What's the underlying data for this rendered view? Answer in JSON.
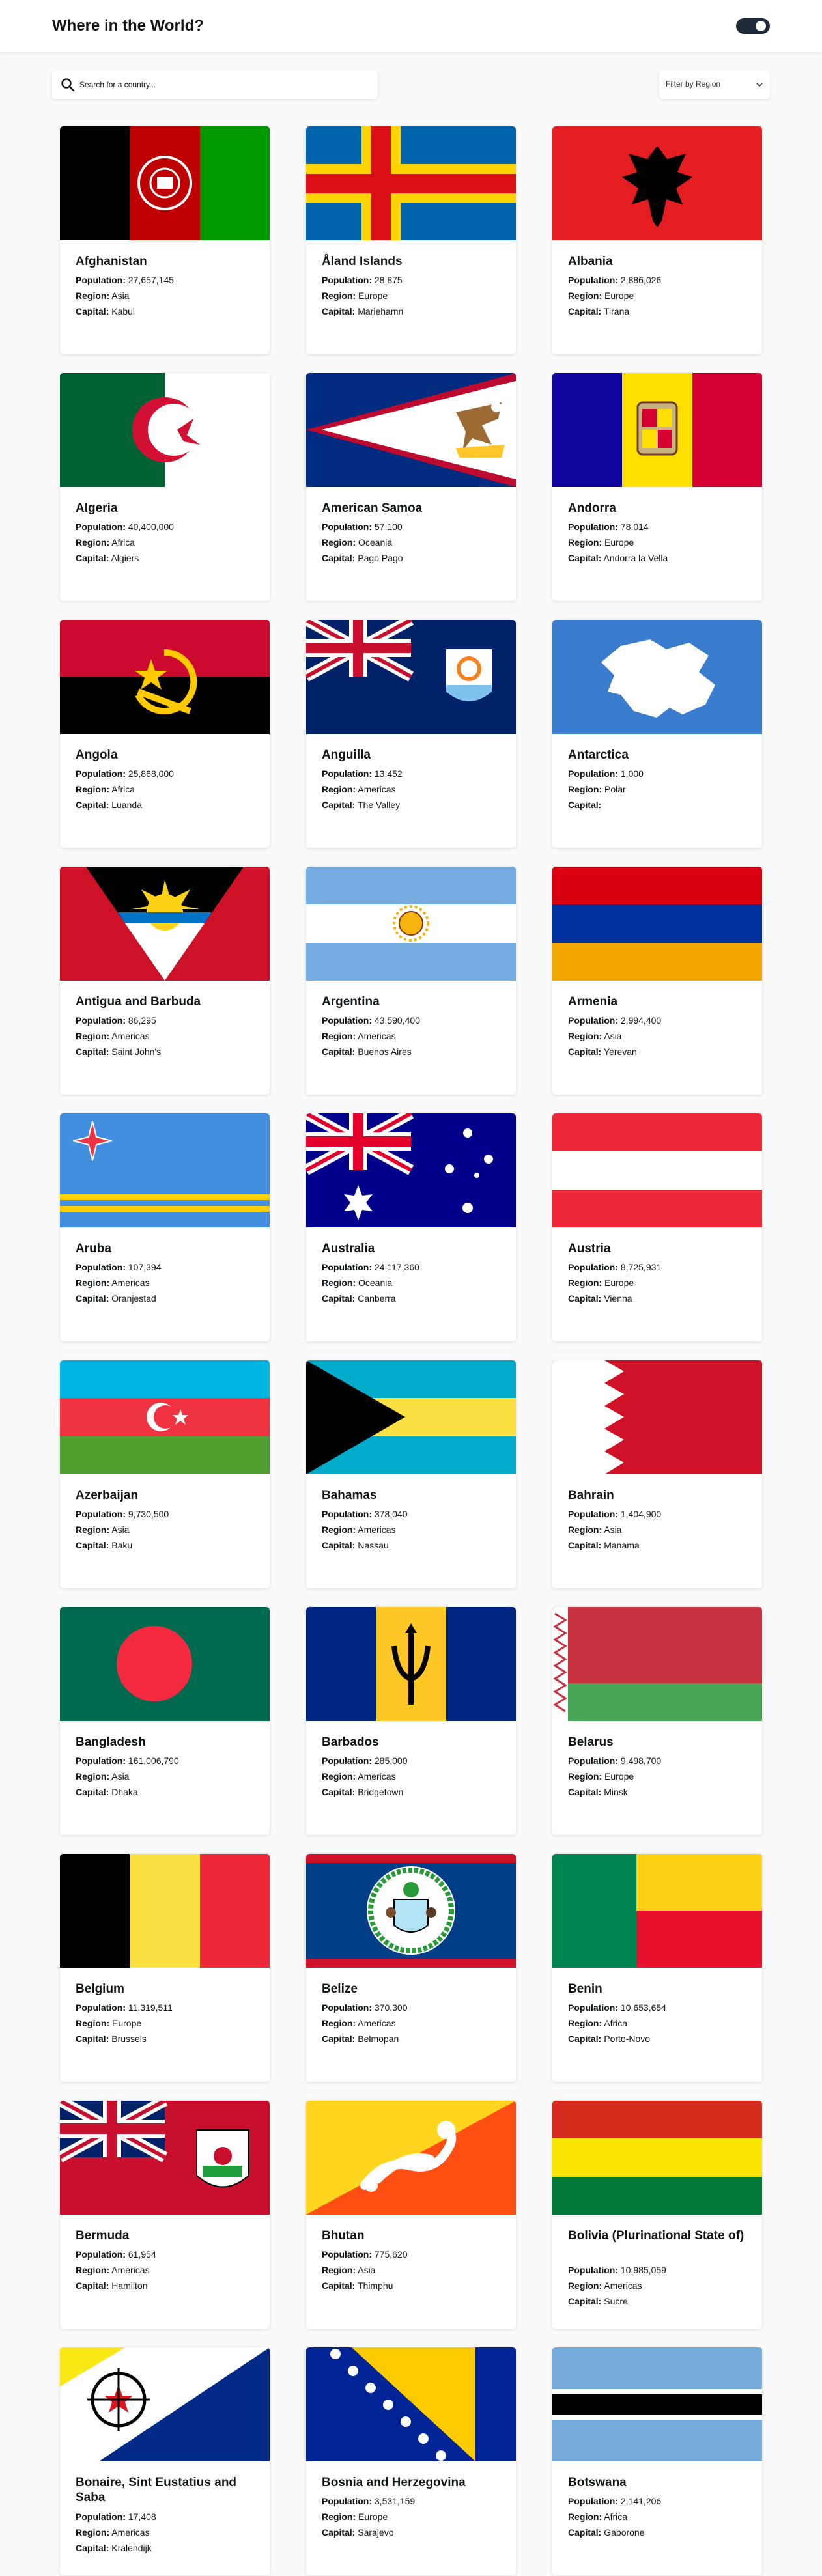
{
  "header": {
    "title": "Where in the World?",
    "theme_toggle": "dark-mode-toggle"
  },
  "search": {
    "placeholder": "Search for a country..."
  },
  "filter": {
    "label": "Filter by Region"
  },
  "labels": {
    "population": "Population:",
    "region": "Region:",
    "capital": "Capital:"
  },
  "countries": [
    {
      "name": "Afghanistan",
      "population": "27,657,145",
      "region": "Asia",
      "capital": "Kabul",
      "flag": "afghanistan"
    },
    {
      "name": "Åland Islands",
      "population": "28,875",
      "region": "Europe",
      "capital": "Mariehamn",
      "flag": "aland"
    },
    {
      "name": "Albania",
      "population": "2,886,026",
      "region": "Europe",
      "capital": "Tirana",
      "flag": "albania"
    },
    {
      "name": "Algeria",
      "population": "40,400,000",
      "region": "Africa",
      "capital": "Algiers",
      "flag": "algeria"
    },
    {
      "name": "American Samoa",
      "population": "57,100",
      "region": "Oceania",
      "capital": "Pago Pago",
      "flag": "american-samoa"
    },
    {
      "name": "Andorra",
      "population": "78,014",
      "region": "Europe",
      "capital": "Andorra la Vella",
      "flag": "andorra"
    },
    {
      "name": "Angola",
      "population": "25,868,000",
      "region": "Africa",
      "capital": "Luanda",
      "flag": "angola"
    },
    {
      "name": "Anguilla",
      "population": "13,452",
      "region": "Americas",
      "capital": "The Valley",
      "flag": "anguilla"
    },
    {
      "name": "Antarctica",
      "population": "1,000",
      "region": "Polar",
      "capital": "",
      "flag": "antarctica"
    },
    {
      "name": "Antigua and Barbuda",
      "population": "86,295",
      "region": "Americas",
      "capital": "Saint John's",
      "flag": "antigua"
    },
    {
      "name": "Argentina",
      "population": "43,590,400",
      "region": "Americas",
      "capital": "Buenos Aires",
      "flag": "argentina"
    },
    {
      "name": "Armenia",
      "population": "2,994,400",
      "region": "Asia",
      "capital": "Yerevan",
      "flag": "armenia"
    },
    {
      "name": "Aruba",
      "population": "107,394",
      "region": "Americas",
      "capital": "Oranjestad",
      "flag": "aruba"
    },
    {
      "name": "Australia",
      "population": "24,117,360",
      "region": "Oceania",
      "capital": "Canberra",
      "flag": "australia"
    },
    {
      "name": "Austria",
      "population": "8,725,931",
      "region": "Europe",
      "capital": "Vienna",
      "flag": "austria"
    },
    {
      "name": "Azerbaijan",
      "population": "9,730,500",
      "region": "Asia",
      "capital": "Baku",
      "flag": "azerbaijan"
    },
    {
      "name": "Bahamas",
      "population": "378,040",
      "region": "Americas",
      "capital": "Nassau",
      "flag": "bahamas"
    },
    {
      "name": "Bahrain",
      "population": "1,404,900",
      "region": "Asia",
      "capital": "Manama",
      "flag": "bahrain"
    },
    {
      "name": "Bangladesh",
      "population": "161,006,790",
      "region": "Asia",
      "capital": "Dhaka",
      "flag": "bangladesh"
    },
    {
      "name": "Barbados",
      "population": "285,000",
      "region": "Americas",
      "capital": "Bridgetown",
      "flag": "barbados"
    },
    {
      "name": "Belarus",
      "population": "9,498,700",
      "region": "Europe",
      "capital": "Minsk",
      "flag": "belarus"
    },
    {
      "name": "Belgium",
      "population": "11,319,511",
      "region": "Europe",
      "capital": "Brussels",
      "flag": "belgium"
    },
    {
      "name": "Belize",
      "population": "370,300",
      "region": "Americas",
      "capital": "Belmopan",
      "flag": "belize"
    },
    {
      "name": "Benin",
      "population": "10,653,654",
      "region": "Africa",
      "capital": "Porto-Novo",
      "flag": "benin"
    },
    {
      "name": "Bermuda",
      "population": "61,954",
      "region": "Americas",
      "capital": "Hamilton",
      "flag": "bermuda"
    },
    {
      "name": "Bhutan",
      "population": "775,620",
      "region": "Asia",
      "capital": "Thimphu",
      "flag": "bhutan"
    },
    {
      "name": "Bolivia (Plurinational State of)",
      "population": "10,985,059",
      "region": "Americas",
      "capital": "Sucre",
      "flag": "bolivia"
    },
    {
      "name": "Bonaire, Sint Eustatius and Saba",
      "population": "17,408",
      "region": "Americas",
      "capital": "Kralendijk",
      "flag": "bonaire"
    },
    {
      "name": "Bosnia and Herzegovina",
      "population": "3,531,159",
      "region": "Europe",
      "capital": "Sarajevo",
      "flag": "bosnia"
    },
    {
      "name": "Botswana",
      "population": "2,141,206",
      "region": "Africa",
      "capital": "Gaborone",
      "flag": "botswana"
    }
  ]
}
